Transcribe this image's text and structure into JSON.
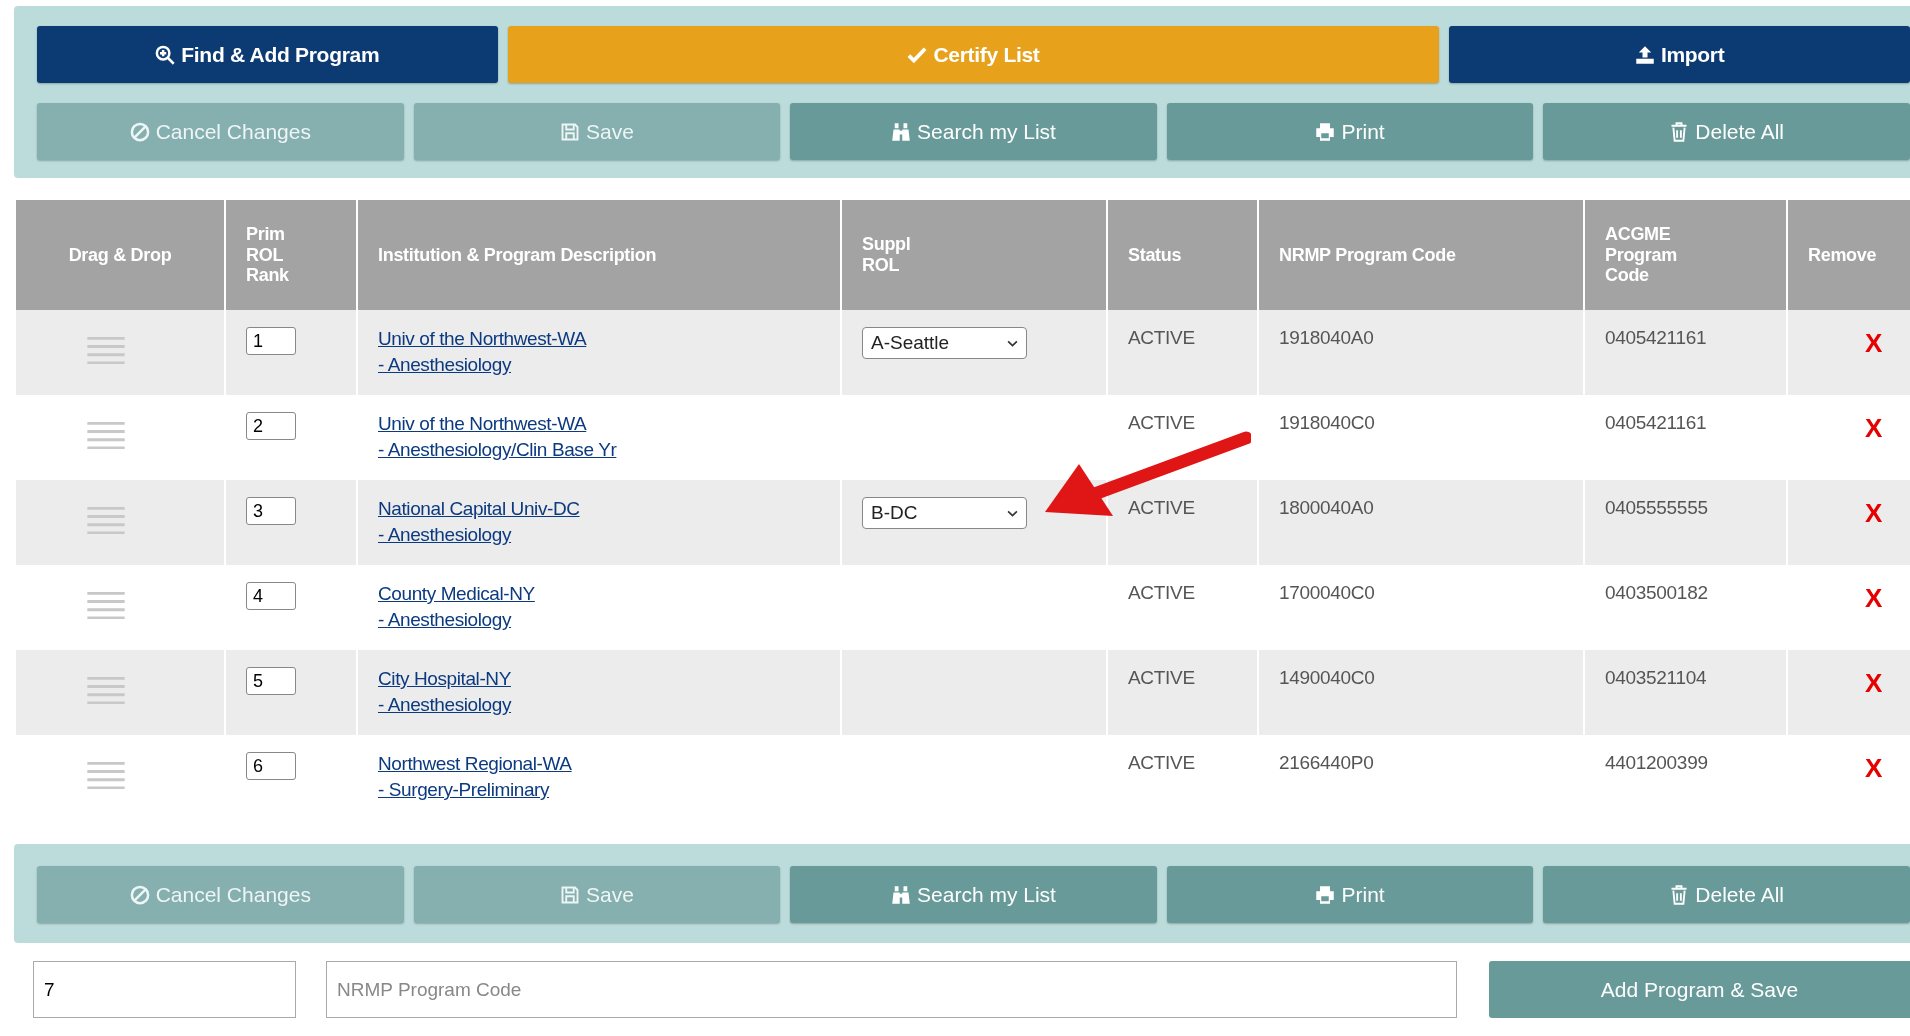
{
  "top_toolbar": [
    {
      "label": "Find & Add Program",
      "kind": "find",
      "disabled": false
    },
    {
      "label": "Certify List",
      "kind": "certify",
      "disabled": false
    },
    {
      "label": "Import",
      "kind": "import",
      "disabled": false
    }
  ],
  "action_toolbar": [
    {
      "label": "Cancel Changes",
      "kind": "cancel",
      "disabled": true
    },
    {
      "label": "Save",
      "kind": "save",
      "disabled": true
    },
    {
      "label": "Search my List",
      "kind": "search",
      "disabled": false
    },
    {
      "label": "Print",
      "kind": "print",
      "disabled": false
    },
    {
      "label": "Delete All",
      "kind": "delete",
      "disabled": false
    }
  ],
  "table": {
    "columns": [
      "Drag & Drop",
      "Prim ROL Rank",
      "Institution & Program Description",
      "Suppl ROL",
      "Status",
      "NRMP Program Code",
      "ACGME Program Code",
      "Remove"
    ],
    "rows": [
      {
        "rank": "1",
        "institution": "Univ of the Northwest-WA",
        "program": "- Anesthesiology",
        "suppl_rol": "A-Seattle",
        "status": "ACTIVE",
        "nrmp_code": "1918040A0",
        "acgme_code": "0405421161",
        "remove": "X"
      },
      {
        "rank": "2",
        "institution": "Univ of the Northwest-WA",
        "program": "- Anesthesiology/Clin Base Yr",
        "status": "ACTIVE",
        "nrmp_code": "1918040C0",
        "acgme_code": "0405421161",
        "remove": "X"
      },
      {
        "rank": "3",
        "institution": "National Capital Univ-DC",
        "program": "- Anesthesiology",
        "suppl_rol": "B-DC",
        "status": "ACTIVE",
        "nrmp_code": "1800040A0",
        "acgme_code": "0405555555",
        "remove": "X"
      },
      {
        "rank": "4",
        "institution": "County Medical-NY",
        "program": "- Anesthesiology",
        "status": "ACTIVE",
        "nrmp_code": "1700040C0",
        "acgme_code": "0403500182",
        "remove": "X"
      },
      {
        "rank": "5",
        "institution": "City Hospital-NY",
        "program": "- Anesthesiology",
        "status": "ACTIVE",
        "nrmp_code": "1490040C0",
        "acgme_code": "0403521104",
        "remove": "X"
      },
      {
        "rank": "6",
        "institution": "Northwest Regional-WA",
        "program": "- Surgery-Preliminary",
        "status": "ACTIVE",
        "nrmp_code": "2166440P0",
        "acgme_code": "4401200399",
        "remove": "X"
      }
    ]
  },
  "bottom_toolbar": [
    {
      "label": "Cancel Changes",
      "kind": "cancel",
      "disabled": true
    },
    {
      "label": "Save",
      "kind": "save",
      "disabled": true
    },
    {
      "label": "Search my List",
      "kind": "search",
      "disabled": false
    },
    {
      "label": "Print",
      "kind": "print",
      "disabled": false
    },
    {
      "label": "Delete All",
      "kind": "delete",
      "disabled": false
    }
  ],
  "add_form": {
    "rank_value": "7",
    "code_placeholder": "NRMP Program Code",
    "button": "Add Program & Save"
  }
}
